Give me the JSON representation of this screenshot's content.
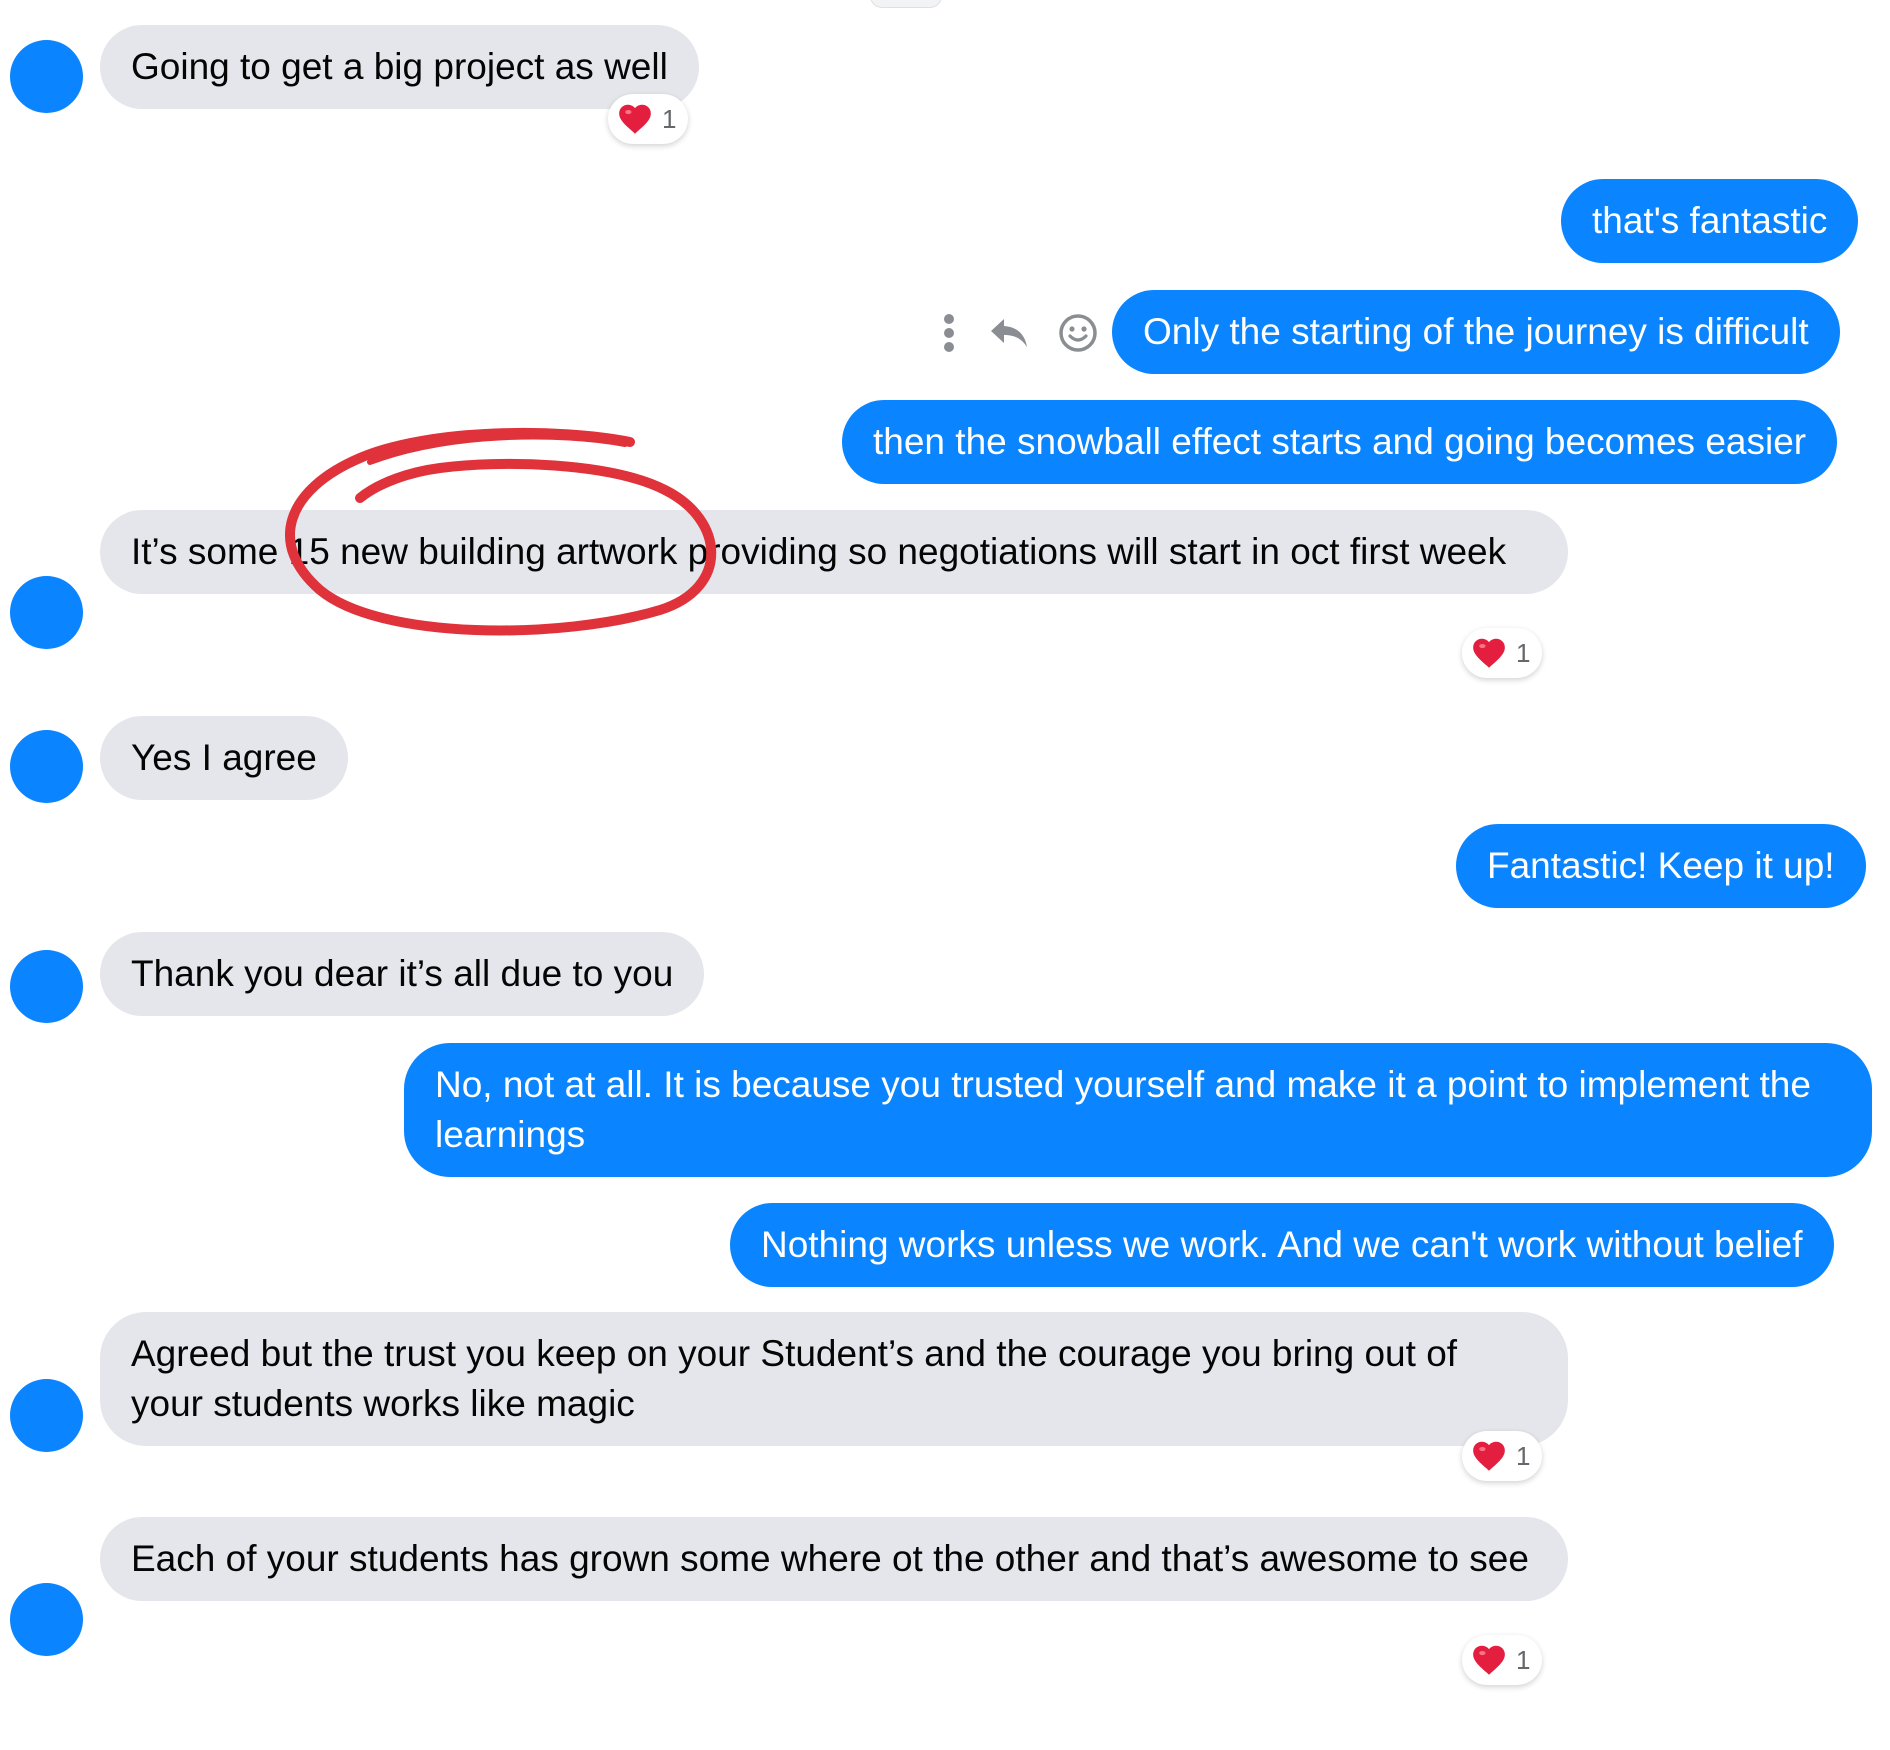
{
  "theme": {
    "outgoing_color": "#0a84ff",
    "incoming_color": "#e4e6eb",
    "avatar_color": "#0a84ff",
    "reaction_heart_color": "#e41e3f",
    "annotation_color": "#e0323a"
  },
  "messages": [
    {
      "id": "m1",
      "direction": "incoming",
      "text": "Going to get a big project as well",
      "reaction": {
        "emoji": "heart",
        "count": "1"
      }
    },
    {
      "id": "m2",
      "direction": "outgoing",
      "text": "that's fantastic"
    },
    {
      "id": "m3",
      "direction": "outgoing",
      "text": "Only the starting of the journey is difficult"
    },
    {
      "id": "m4",
      "direction": "outgoing",
      "text": "then the snowball effect starts and going becomes easier"
    },
    {
      "id": "m5",
      "direction": "incoming",
      "text": "It’s some 15  new building artwork providing so negotiations will start in oct first week",
      "reaction": {
        "emoji": "heart",
        "count": "1"
      }
    },
    {
      "id": "m6",
      "direction": "incoming",
      "text": "Yes I agree"
    },
    {
      "id": "m7",
      "direction": "outgoing",
      "text": "Fantastic! Keep it up!"
    },
    {
      "id": "m8",
      "direction": "incoming",
      "text": "Thank you dear it’s all due to you"
    },
    {
      "id": "m9",
      "direction": "outgoing",
      "text": "No, not at all. It is because you trusted yourself and make it a point to implement the learnings"
    },
    {
      "id": "m10",
      "direction": "outgoing",
      "text": "Nothing works unless we work. And we can't work without belief"
    },
    {
      "id": "m11",
      "direction": "incoming",
      "text": "Agreed but the trust you keep on your Student’s and the courage you bring out of your students works like magic",
      "reaction": {
        "emoji": "heart",
        "count": "1"
      }
    },
    {
      "id": "m12",
      "direction": "incoming",
      "text": "Each of your students has grown some where ot the other and that’s awesome to see",
      "reaction": {
        "emoji": "heart",
        "count": "1"
      }
    }
  ],
  "hover_toolbar": {
    "icons": [
      "more-icon",
      "reply-icon",
      "react-icon"
    ]
  }
}
